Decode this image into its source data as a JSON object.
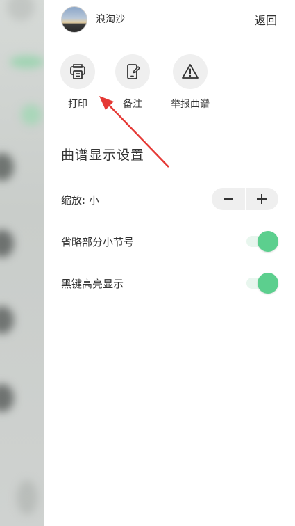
{
  "header": {
    "username": "浪淘沙",
    "back_label": "返回"
  },
  "actions": [
    {
      "label": "打印",
      "icon": "printer-icon"
    },
    {
      "label": "备注",
      "icon": "note-edit-icon"
    },
    {
      "label": "举报曲谱",
      "icon": "warning-icon"
    }
  ],
  "settings": {
    "title": "曲谱显示设置",
    "zoom_label": "缩放: 小",
    "zoom_minus": "−",
    "zoom_plus": "+",
    "omit_measures_label": "省略部分小节号",
    "omit_measures_on": true,
    "black_keys_label": "黑键高亮显示",
    "black_keys_on": true
  },
  "colors": {
    "accent": "#5ccf8e",
    "arrow": "#e53935"
  }
}
